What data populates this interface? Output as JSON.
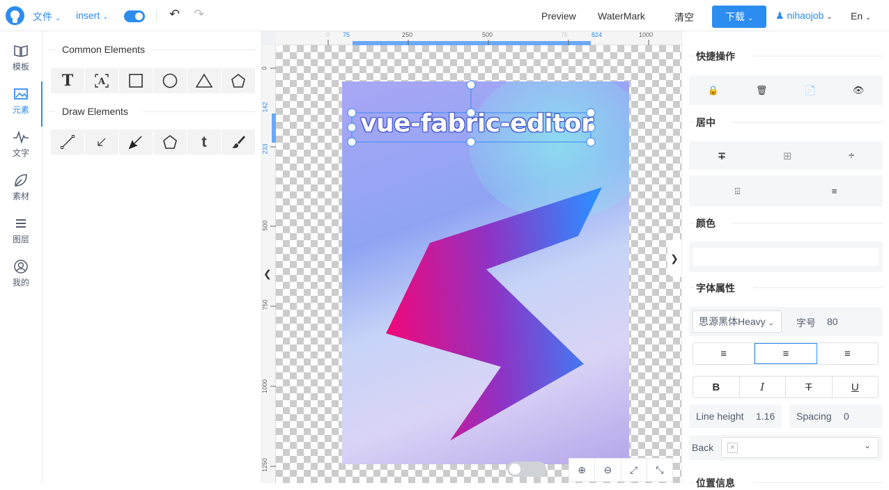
{
  "header": {
    "file_menu": "文件",
    "insert_menu": "insert",
    "preview": "Preview",
    "watermark": "WaterMark",
    "clear": "清空",
    "download": "下载",
    "user": "nihaojob",
    "lang": "En"
  },
  "nav": {
    "items": [
      {
        "label": "模板",
        "icon": "book-icon"
      },
      {
        "label": "元素",
        "icon": "image-icon"
      },
      {
        "label": "文字",
        "icon": "pulse-icon"
      },
      {
        "label": "素材",
        "icon": "leaf-icon"
      },
      {
        "label": "图层",
        "icon": "layers-icon"
      },
      {
        "label": "我的",
        "icon": "user-icon"
      }
    ],
    "active": "元素"
  },
  "elements_panel": {
    "common_title": "Common Elements",
    "draw_title": "Draw Elements",
    "common_tools": [
      "text-icon",
      "textbox-icon",
      "rectangle-icon",
      "circle-icon",
      "triangle-icon",
      "polygon-icon"
    ],
    "draw_tools": [
      "line-icon",
      "arrow-icon",
      "thin-arrow-icon",
      "polygon-draw-icon",
      "tumblr-text-icon",
      "brush-icon"
    ]
  },
  "ruler": {
    "top_ticks": [
      "0",
      "75",
      "250",
      "500",
      "75",
      "824",
      "1000"
    ],
    "left_ticks": [
      "0",
      "142",
      "233",
      "500",
      "750",
      "1000",
      "1250"
    ]
  },
  "canvas": {
    "text": "vue-fabric-editor",
    "colors": {
      "accent": "#2d8cf0",
      "selection": "#4a90f5"
    }
  },
  "right_panel": {
    "quick_ops": "快捷操作",
    "center": "居中",
    "color": "颜色",
    "font_props": "字体属性",
    "font_family": "思源黑体Heavy",
    "font_size_label": "字号",
    "font_size": "80",
    "line_height_label": "Line height",
    "line_height": "1.16",
    "spacing_label": "Spacing",
    "spacing": "0",
    "back_label": "Back",
    "position_info": "位置信息"
  }
}
